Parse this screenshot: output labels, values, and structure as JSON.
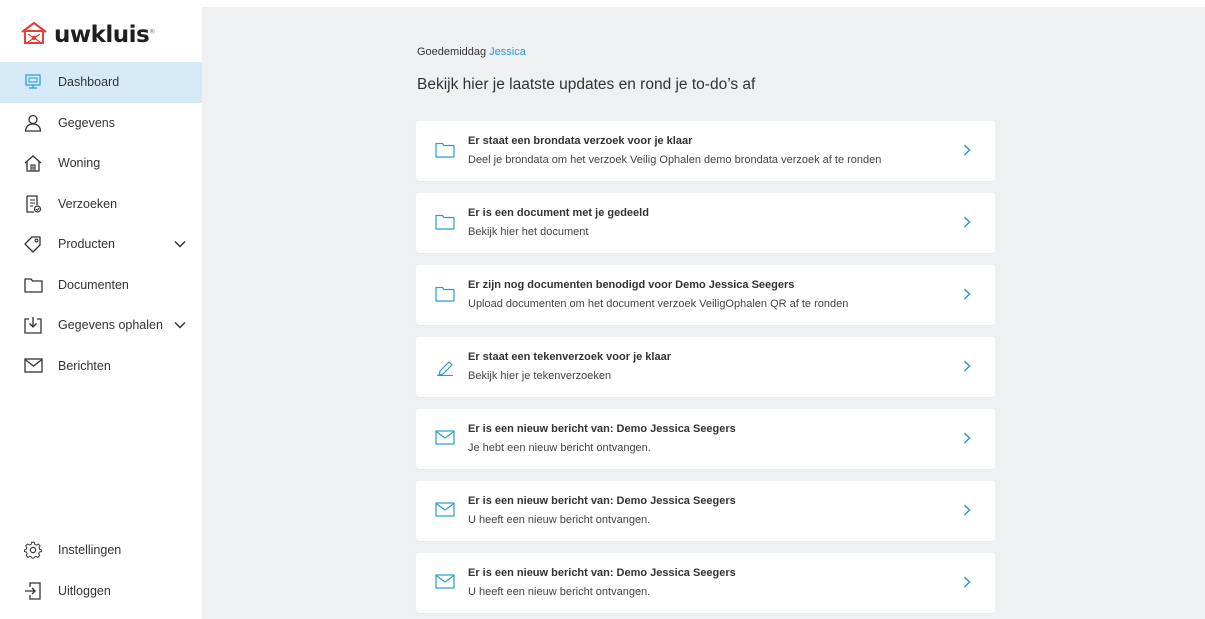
{
  "brand": {
    "name": "uwkluis",
    "mark": "®"
  },
  "colors": {
    "accent": "#2a9bd6",
    "active_bg": "#d6e9f6",
    "main_bg": "#eef0f2",
    "logo_red": "#e0413f"
  },
  "sidebar": {
    "items": [
      {
        "label": "Dashboard",
        "icon": "dashboard-icon",
        "active": true
      },
      {
        "label": "Gegevens",
        "icon": "user-icon"
      },
      {
        "label": "Woning",
        "icon": "house-icon"
      },
      {
        "label": "Verzoeken",
        "icon": "request-document-icon"
      },
      {
        "label": "Producten",
        "icon": "tag-icon",
        "expandable": true
      },
      {
        "label": "Documenten",
        "icon": "folder-icon"
      },
      {
        "label": "Gegevens ophalen",
        "icon": "download-tray-icon",
        "expandable": true
      },
      {
        "label": "Berichten",
        "icon": "envelope-icon"
      }
    ],
    "bottom": [
      {
        "label": "Instellingen",
        "icon": "gear-icon"
      },
      {
        "label": "Uitloggen",
        "icon": "logout-icon"
      }
    ]
  },
  "main": {
    "greeting_prefix": "Goedemiddag",
    "greeting_name": "Jessica",
    "headline": "Bekijk hier je laatste updates en rond je to-do’s af",
    "cards": [
      {
        "icon": "folder-icon",
        "title": "Er staat een brondata verzoek voor je klaar",
        "subtitle": "Deel je brondata om het verzoek Veilig Ophalen demo brondata verzoek af te ronden"
      },
      {
        "icon": "folder-icon",
        "title": "Er is een document met je gedeeld",
        "subtitle": "Bekijk hier het document"
      },
      {
        "icon": "folder-icon",
        "title": "Er zijn nog documenten benodigd voor Demo Jessica Seegers",
        "subtitle": "Upload documenten om het document verzoek VeiligOphalen QR af te ronden"
      },
      {
        "icon": "pencil-icon",
        "title": "Er staat een tekenverzoek voor je klaar",
        "subtitle": "Bekijk hier je tekenverzoeken"
      },
      {
        "icon": "envelope-icon",
        "title": "Er is een nieuw bericht van: Demo Jessica Seegers",
        "subtitle": "Je hebt een nieuw bericht ontvangen."
      },
      {
        "icon": "envelope-icon",
        "title": "Er is een nieuw bericht van: Demo Jessica Seegers",
        "subtitle": "U heeft een nieuw bericht ontvangen."
      },
      {
        "icon": "envelope-icon",
        "title": "Er is een nieuw bericht van: Demo Jessica Seegers",
        "subtitle": "U heeft een nieuw bericht ontvangen."
      }
    ]
  }
}
